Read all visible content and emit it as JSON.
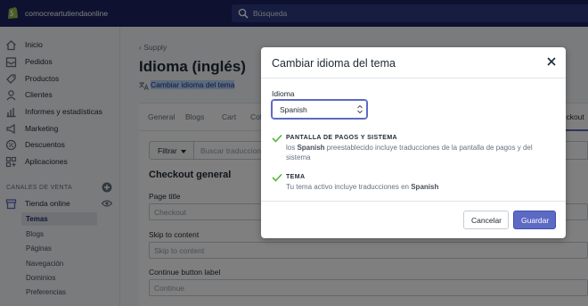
{
  "topbar": {
    "store_name": "comocreartutiendaonline",
    "search_placeholder": "Búsqueda"
  },
  "sidebar": {
    "items": [
      {
        "label": "Inicio",
        "icon": "home-icon"
      },
      {
        "label": "Pedidos",
        "icon": "orders-icon"
      },
      {
        "label": "Productos",
        "icon": "products-icon"
      },
      {
        "label": "Clientes",
        "icon": "customers-icon"
      },
      {
        "label": "Informes y estadísticas",
        "icon": "analytics-icon"
      },
      {
        "label": "Marketing",
        "icon": "marketing-icon"
      },
      {
        "label": "Descuentos",
        "icon": "discounts-icon"
      },
      {
        "label": "Aplicaciones",
        "icon": "apps-icon"
      }
    ],
    "section_title": "CANALES DE VENTA",
    "channel": "Tienda online",
    "sub_items": [
      "Temas",
      "Blogs",
      "Páginas",
      "Navegación",
      "Dominios",
      "Preferencias"
    ],
    "active_sub_item": "Temas"
  },
  "main": {
    "breadcrumb": "Supply",
    "title": "Idioma (inglés)",
    "change_link": "Cambiar idioma del tema",
    "tabs": [
      "General",
      "Blogs",
      "Cart",
      "Col"
    ],
    "active_tab": "heckout",
    "filter_label": "Filtrar",
    "search_placeholder": "Buscar traducciones",
    "section_heading": "Checkout general",
    "fields": [
      {
        "label": "Page title",
        "value": "Checkout"
      },
      {
        "label": "Skip to content",
        "value": "Skip to content"
      },
      {
        "label": "Continue button label",
        "value": "Continue"
      }
    ]
  },
  "modal": {
    "title": "Cambiar idioma del tema",
    "language_label": "Idioma",
    "language_value": "Spanish",
    "features": [
      {
        "title": "PANTALLA DE PAGOS Y SISTEMA",
        "desc_pre": "los ",
        "desc_bold": "Spanish",
        "desc_post": " preestablecido incluye traducciones de la pantalla de pagos y del sistema"
      },
      {
        "title": "TEMA",
        "desc_pre": "Tu tema activo incluye traducciones en ",
        "desc_bold": "Spanish",
        "desc_post": ""
      }
    ],
    "cancel_label": "Cancelar",
    "save_label": "Guardar"
  },
  "colors": {
    "topbar": "#1c2260",
    "primary": "#5c6ac4",
    "check": "#50b83c"
  }
}
